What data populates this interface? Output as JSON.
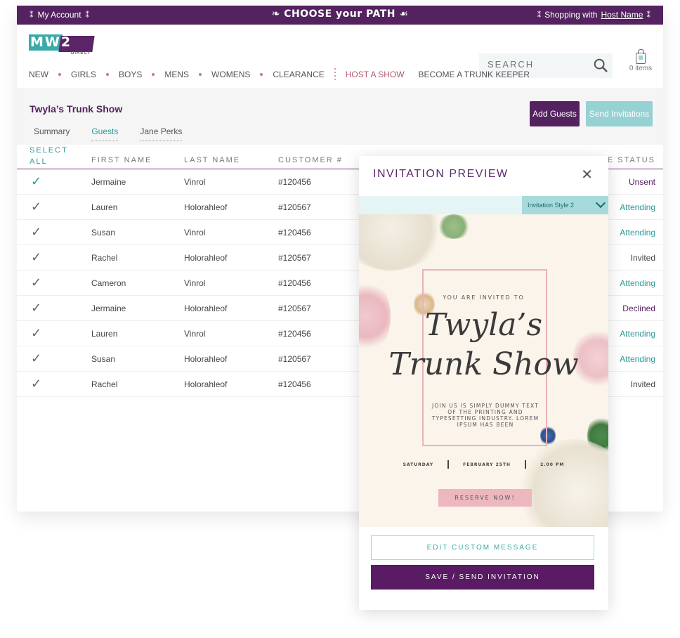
{
  "topbar": {
    "my_account": "My Account",
    "brand_slogan": "CHOOSE your PATH",
    "shopping_with": "Shopping with",
    "host_name": "Host Name"
  },
  "header": {
    "logo_text": "MW2",
    "logo_sub": "DIRECT",
    "search_placeholder": "SEARCH",
    "cart_count": "0 items"
  },
  "nav": {
    "items": [
      "NEW",
      "GIRLS",
      "BOYS",
      "MENS",
      "WOMENS",
      "CLEARANCE"
    ],
    "host": "HOST A SHOW",
    "trunk_keeper": "BECOME A TRUNK KEEPER"
  },
  "event": {
    "title": "Twyla’s Trunk Show",
    "tabs": [
      {
        "label": "Summary",
        "active": false
      },
      {
        "label": "Guests",
        "active": true
      },
      {
        "label": "Jane Perks",
        "active": false
      }
    ],
    "add_guests": "Add Guests",
    "send_invitations": "Send Invitations"
  },
  "table": {
    "select_all_1": "SELECT",
    "select_all_2": "ALL",
    "columns": [
      "FIRST NAME",
      "LAST NAME",
      "CUSTOMER #",
      "TE STATUS"
    ],
    "rows": [
      {
        "checked": true,
        "first": "Jermaine",
        "last": "Vinrol",
        "customer": "#120456",
        "status": "Unsent"
      },
      {
        "checked": false,
        "first": "Lauren",
        "last": "Holorahleof",
        "customer": "#120567",
        "status": "Attending"
      },
      {
        "checked": false,
        "first": "Susan",
        "last": "Vinrol",
        "customer": "#120456",
        "status": "Attending"
      },
      {
        "checked": false,
        "first": "Rachel",
        "last": "Holorahleof",
        "customer": "#120567",
        "status": "Invited"
      },
      {
        "checked": false,
        "first": "Cameron",
        "last": "Vinrol",
        "customer": "#120456",
        "status": "Attending"
      },
      {
        "checked": false,
        "first": "Jermaine",
        "last": "Holorahleof",
        "customer": "#120567",
        "status": "Declined"
      },
      {
        "checked": false,
        "first": "Lauren",
        "last": "Vinrol",
        "customer": "#120456",
        "status": "Attending"
      },
      {
        "checked": false,
        "first": "Susan",
        "last": "Holorahleof",
        "customer": "#120567",
        "status": "Attending"
      },
      {
        "checked": false,
        "first": "Rachel",
        "last": "Holorahleof",
        "customer": "#120456",
        "status": "Invited"
      }
    ]
  },
  "modal": {
    "title": "INVITATION PREVIEW",
    "style_selected": "Invitation Style 2",
    "card": {
      "invited": "YOU ARE INVITED TO",
      "script_1": "Twyla’s",
      "script_2": "Trunk Show",
      "message": "JOIN US IS SIMPLY DUMMY TEXT OF THE PRINTING AND TYPESETTING INDUSTRY. LOREM IPSUM HAS BEEN",
      "day": "SATURDAY",
      "date": "FEBRUARY 25TH",
      "time": "2.00 PM",
      "reserve": "RESERVE NOW!"
    },
    "edit_message": "EDIT CUSTOM MESSAGE",
    "save_send": "SAVE / SEND INVITATION"
  },
  "colors": {
    "brand_purple": "#54225f",
    "brand_teal": "#2e9a99",
    "send_disabled": "#96d1d3",
    "card_bg": "#fbf4ea",
    "frame_pink": "#e8b3bb"
  }
}
